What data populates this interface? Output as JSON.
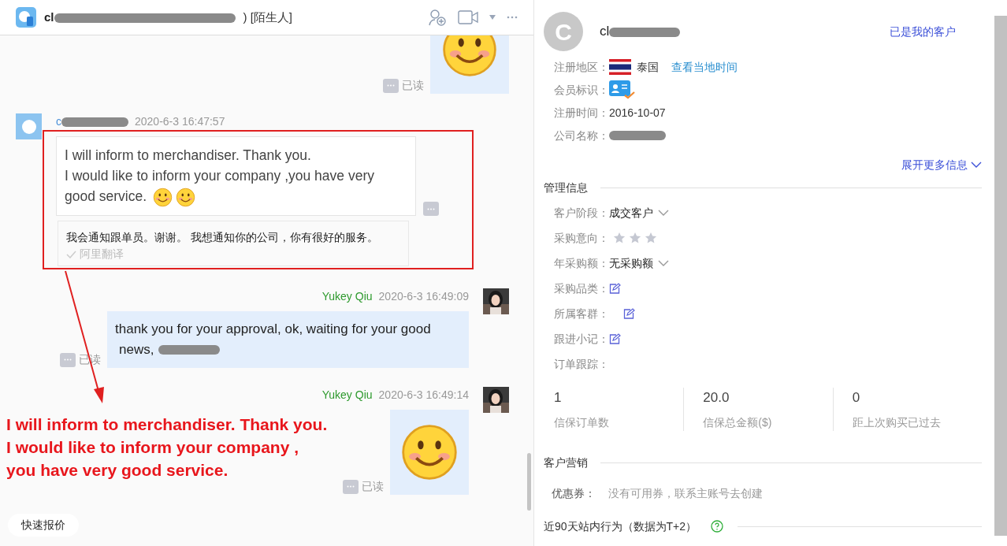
{
  "chat": {
    "title_start": "cl",
    "title_end": ") [陌生人]",
    "messages": [
      {
        "kind": "sticker",
        "outgoing": true,
        "read_label": "已读",
        "cut_top": true
      },
      {
        "kind": "text",
        "outgoing": false,
        "sender": "c",
        "time": "2020-6-3 16:47:57",
        "lines": [
          "I will inform to merchandiser. Thank you.",
          "I would like to inform your company ,you have very good service."
        ],
        "emojis": [
          {
            "kind": "smile"
          },
          {
            "kind": "smile"
          }
        ],
        "translation": "我会通知跟单员。谢谢。 我想通知你的公司，你有很好的服务。",
        "translation_label": "阿里翻译"
      },
      {
        "kind": "text",
        "outgoing": true,
        "sender": "Yukey Qiu",
        "time": "2020-6-3 16:49:09",
        "lines": [
          "thank you for your approval, ok, waiting for your good",
          "news,"
        ],
        "redacted_tail": true,
        "read_label": "已读"
      },
      {
        "kind": "sticker",
        "outgoing": true,
        "sender": "Yukey Qiu",
        "time": "2020-6-3 16:49:14",
        "read_label": "已读",
        "cut_top": false
      }
    ],
    "quick_button": "快速报价"
  },
  "annotation": {
    "lines": [
      "I will inform to merchandiser. Thank you.",
      "I would like to inform your company ,",
      "you have very good service."
    ]
  },
  "profile": {
    "avatar_letter": "C",
    "name_start": "cl",
    "status_link": "已是我的客户",
    "info": [
      {
        "label": "注册地区：",
        "kind": "country",
        "value": "泰国",
        "link": "查看当地时间"
      },
      {
        "label": "会员标识：",
        "kind": "badge"
      },
      {
        "label": "注册时间：",
        "kind": "text",
        "value": "2016-10-07"
      },
      {
        "label": "公司名称：",
        "kind": "redacted"
      }
    ],
    "expand_link": "展开更多信息",
    "management": {
      "title": "管理信息",
      "rows": [
        {
          "label": "客户阶段：",
          "kind": "dropdown",
          "value": "成交客户"
        },
        {
          "label": "采购意向：",
          "kind": "stars",
          "stars": 0
        },
        {
          "label": "年采购额：",
          "kind": "dropdown",
          "value": "无采购额"
        },
        {
          "label": "采购品类：",
          "kind": "edit"
        },
        {
          "label": "所属客群：",
          "kind": "edit_gap"
        },
        {
          "label": "跟进小记：",
          "kind": "edit"
        },
        {
          "label": "订单跟踪：",
          "kind": "empty"
        }
      ]
    },
    "stats": [
      {
        "value": "1",
        "label": "信保订单数"
      },
      {
        "value": "20.0",
        "label": "信保总金额($)"
      },
      {
        "value": "0",
        "label": "距上次购买已过去"
      }
    ],
    "marketing": {
      "title": "客户营销",
      "coupon_label": "优惠券：",
      "coupon_text": "没有可用券，联系主账号去创建"
    },
    "behavior": {
      "title": "近90天站内行为（数据为T+2）"
    }
  }
}
